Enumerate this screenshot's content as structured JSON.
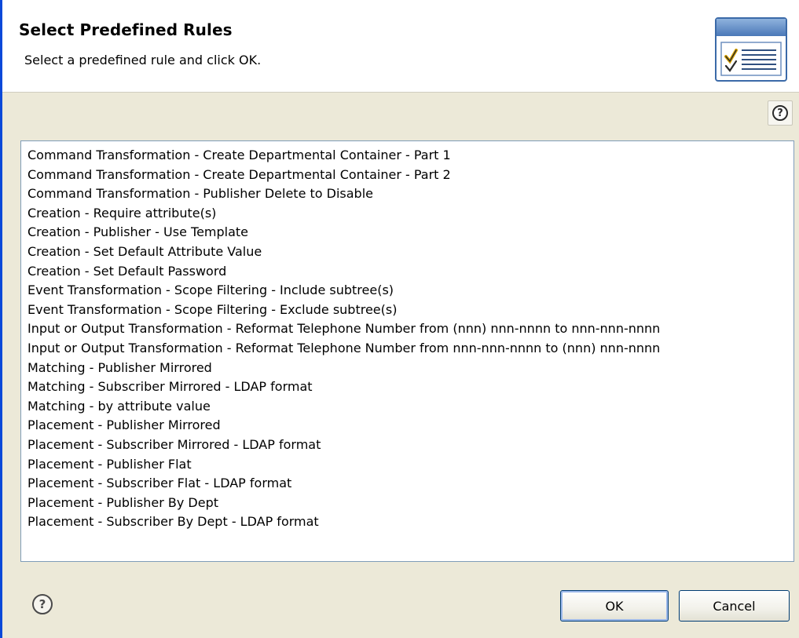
{
  "banner": {
    "title": "Select Predefined Rules",
    "message": "Select a predefined rule and click OK.",
    "icon": "checklist-icon"
  },
  "help": {
    "top_icon": "help-icon",
    "bottom_icon": "help-icon",
    "glyph": "?"
  },
  "rules": [
    "Command Transformation - Create Departmental Container - Part 1",
    "Command Transformation - Create Departmental Container - Part 2",
    "Command Transformation - Publisher Delete to Disable",
    "Creation - Require attribute(s)",
    "Creation - Publisher - Use Template",
    "Creation - Set Default Attribute Value",
    "Creation - Set Default Password",
    "Event Transformation - Scope Filtering - Include subtree(s)",
    "Event Transformation - Scope Filtering - Exclude subtree(s)",
    "Input or Output Transformation - Reformat Telephone Number from (nnn) nnn-nnnn to nnn-nnn-nnnn",
    "Input or Output Transformation - Reformat Telephone Number from nnn-nnn-nnnn to (nnn) nnn-nnnn",
    "Matching - Publisher Mirrored",
    "Matching - Subscriber Mirrored - LDAP format",
    "Matching - by attribute value",
    "Placement - Publisher Mirrored",
    "Placement - Subscriber Mirrored - LDAP format",
    "Placement - Publisher Flat",
    "Placement - Subscriber Flat - LDAP format",
    "Placement - Publisher By Dept",
    "Placement - Subscriber By Dept - LDAP format"
  ],
  "buttons": {
    "ok_label": "OK",
    "cancel_label": "Cancel"
  },
  "colors": {
    "window_border": "#0a49d9",
    "dialog_background": "#ece9d8",
    "banner_background": "#ffffff",
    "list_border": "#7f9db9"
  }
}
